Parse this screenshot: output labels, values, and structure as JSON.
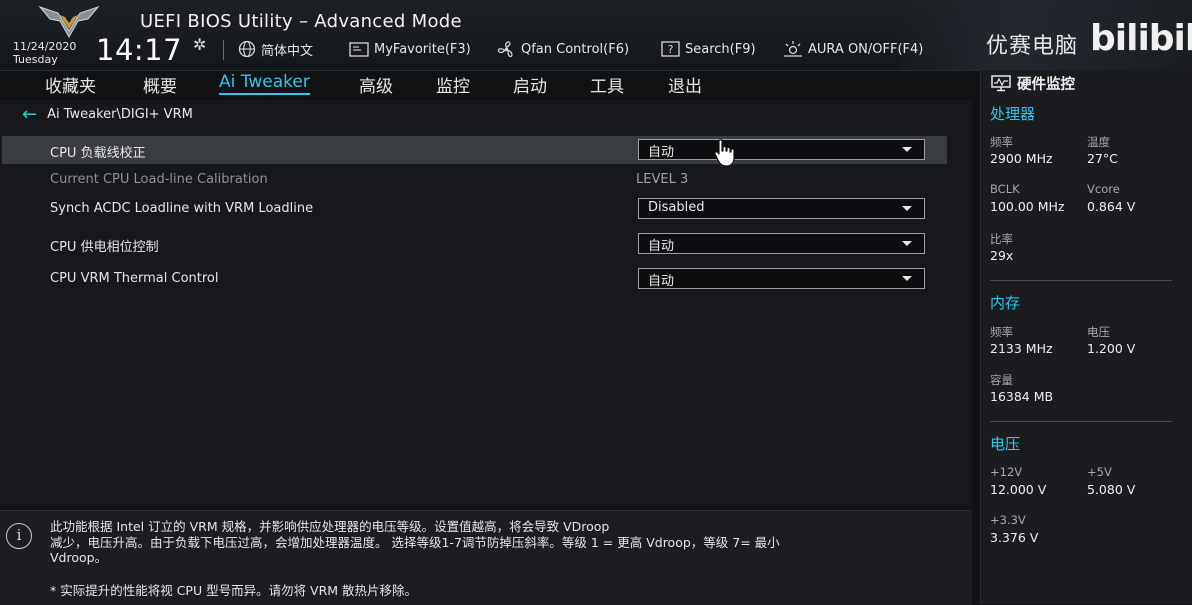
{
  "header": {
    "title": "UEFI BIOS Utility – Advanced Mode",
    "date": "11/24/2020",
    "weekday": "Tuesday",
    "time": "14:17",
    "tools": [
      {
        "label": "简体中文",
        "icon": "globe-icon"
      },
      {
        "label": "MyFavorite(F3)",
        "icon": "favorite-icon"
      },
      {
        "label": "Qfan Control(F6)",
        "icon": "fan-icon"
      },
      {
        "label": "Search(F9)",
        "icon": "search-help-icon"
      },
      {
        "label": "AURA ON/OFF(F4)",
        "icon": "aura-icon"
      }
    ],
    "watermark_text": "优赛电脑",
    "watermark_logo": "bilibili"
  },
  "menu": {
    "items": [
      "收藏夹",
      "概要",
      "Ai Tweaker",
      "高级",
      "监控",
      "启动",
      "工具",
      "退出"
    ],
    "active": "Ai Tweaker"
  },
  "main": {
    "breadcrumb": "Ai Tweaker\\DIGI+ VRM",
    "settings": [
      {
        "label": "CPU 负载线校正",
        "type": "dropdown",
        "value": "自动",
        "selected": true
      },
      {
        "label": "Current CPU Load-line Calibration",
        "type": "readonly",
        "value": "LEVEL 3"
      },
      {
        "label": "Synch ACDC Loadline with VRM Loadline",
        "type": "dropdown",
        "value": "Disabled"
      },
      {
        "label": "CPU 供电相位控制",
        "type": "dropdown",
        "value": "自动"
      },
      {
        "label": "CPU VRM Thermal Control",
        "type": "dropdown",
        "value": "自动"
      }
    ]
  },
  "help": {
    "line1": "此功能根据 Intel 订立的 VRM 规格，并影响供应处理器的电压等级。设置值越高，将会导致 VDroop",
    "line2": "减少，电压升高。由于负载下电压过高，会增加处理器温度。 选择等级1-7调节防掉压斜率。等级 1 = 更高 Vdroop，等级 7= 最小",
    "line3": "Vdroop。",
    "note": "* 实际提升的性能将视 CPU 型号而异。请勿将 VRM 散热片移除。"
  },
  "monitor": {
    "title": "硬件监控",
    "cpu": {
      "title": "处理器",
      "freq_label": "频率",
      "freq": "2900 MHz",
      "temp_label": "温度",
      "temp": "27°C",
      "bclk_label": "BCLK",
      "bclk": "100.00 MHz",
      "vcore_label": "Vcore",
      "vcore": "0.864 V",
      "ratio_label": "比率",
      "ratio": "29x"
    },
    "memory": {
      "title": "内存",
      "freq_label": "频率",
      "freq": "2133 MHz",
      "volt_label": "电压",
      "volt": "1.200 V",
      "cap_label": "容量",
      "cap": "16384 MB"
    },
    "voltage": {
      "title": "电压",
      "v12_label": "+12V",
      "v12": "12.000 V",
      "v5_label": "+5V",
      "v5": "5.080 V",
      "v33_label": "+3.3V",
      "v33": "3.376 V"
    }
  },
  "colors": {
    "accent": "#2fc6e8",
    "selected_row": "#3a3d40",
    "background": "#16181b"
  }
}
